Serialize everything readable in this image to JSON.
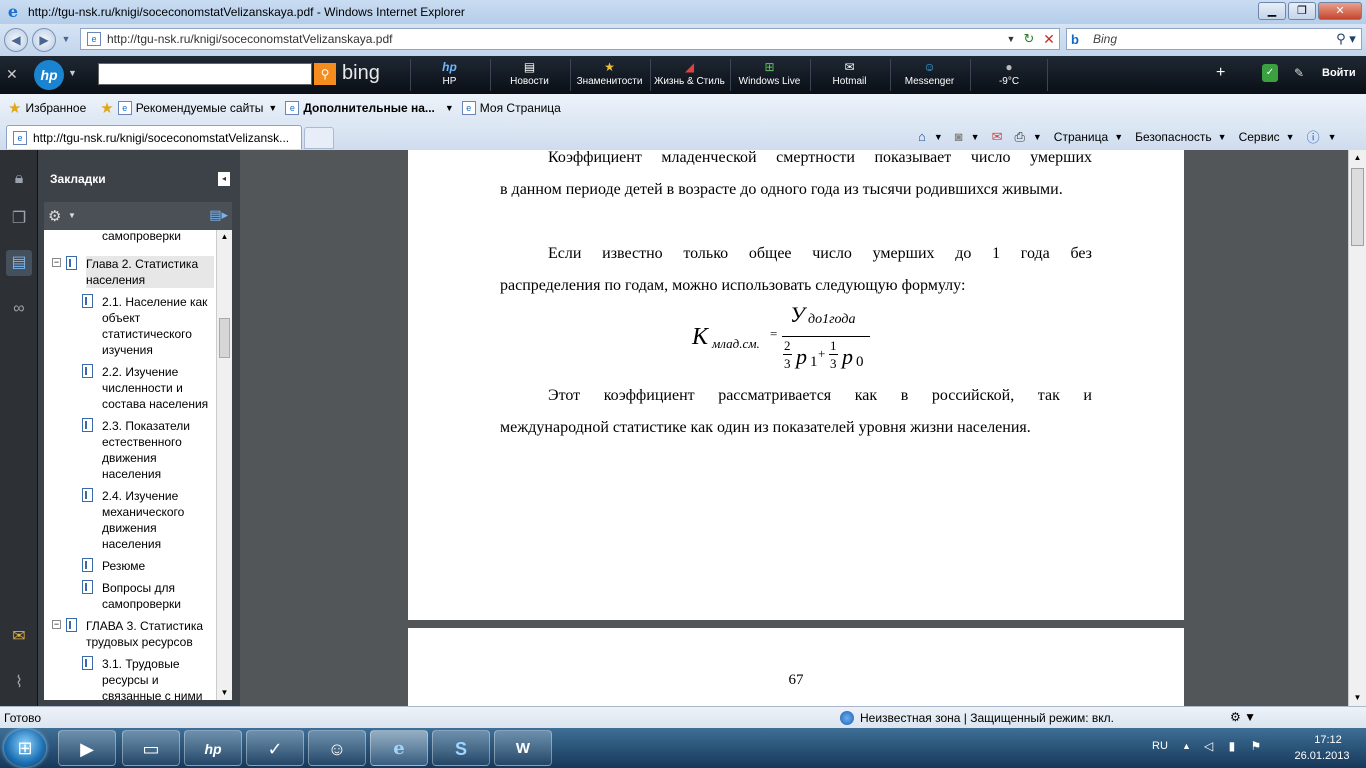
{
  "window": {
    "title": "http://tgu-nsk.ru/knigi/soceconomstatVelizanskaya.pdf - Windows Internet Explorer"
  },
  "address_bar": {
    "url": "http://tgu-nsk.ru/knigi/soceconomstatVelizanskaya.pdf",
    "search_placeholder": "Bing"
  },
  "hp_toolbar": {
    "search_value": "",
    "brand": "bing",
    "tools": [
      {
        "label": "HP",
        "icon": "hp-icon"
      },
      {
        "label": "Новости",
        "icon": "news-icon"
      },
      {
        "label": "Знаменитости",
        "icon": "star-icon"
      },
      {
        "label": "Жизнь & Стиль",
        "icon": "shoe-icon"
      },
      {
        "label": "Windows Live",
        "icon": "windows-icon"
      },
      {
        "label": "Hotmail",
        "icon": "mail-icon"
      },
      {
        "label": "Messenger",
        "icon": "messenger-icon"
      },
      {
        "label": "-9°C",
        "icon": "weather-icon"
      }
    ],
    "signin": "Войти"
  },
  "favorites_bar": {
    "favorites": "Избранное",
    "items": [
      "Рекомендуемые сайты",
      "Дополнительные на...",
      "Моя Страница"
    ]
  },
  "tabs": {
    "active_tab": "http://tgu-nsk.ru/knigi/soceconomstatVelizansk..."
  },
  "command_bar": {
    "page": "Страница",
    "safety": "Безопасность",
    "tools": "Сервис"
  },
  "bookmarks": {
    "header": "Закладки",
    "items": [
      {
        "text": "самопроверки",
        "level": 2
      },
      {
        "text": "Глава 2. Статистика населения",
        "level": 1,
        "expanded": true,
        "selected": true
      },
      {
        "text": "2.1. Население как объект статистического изучения",
        "level": 2
      },
      {
        "text": "2.2. Изучение численности и состава населения",
        "level": 2
      },
      {
        "text": "2.3. Показатели естественного движения населения",
        "level": 2
      },
      {
        "text": "2.4. Изучение механического движения населения",
        "level": 2
      },
      {
        "text": "Резюме",
        "level": 2
      },
      {
        "text": "Вопросы для самопроверки",
        "level": 2
      },
      {
        "text": "ГЛАВА 3. Статистика трудовых ресурсов",
        "level": 1,
        "expanded": true
      },
      {
        "text": "3.1. Трудовые ресурсы и связанные с ними",
        "level": 2
      }
    ]
  },
  "document": {
    "para1_line0": "Коэффициент младенческой смертности показывает число умерших",
    "para1_rest": "в данном периоде детей в возрасте до одного года из тысячи родившихся живыми.",
    "para2_first": "Если известно только общее число умерших до 1 года без",
    "para2_rest": "распределения по годам, можно использовать следующую формулу:",
    "formula": {
      "lhs": "К",
      "lhs_sub": "млад.см.",
      "eq": "=",
      "num": "У",
      "num_sub": "до1года",
      "frac1_num": "2",
      "frac1_den": "3",
      "p1": "p",
      "p1_sub": "1",
      "plus": "+",
      "frac2_num": "1",
      "frac2_den": "3",
      "p0": "p",
      "p0_sub": "0"
    },
    "para3_first": "Этот коэффициент рассматривается как в российской, так и",
    "para3_rest": "международной статистике как один из показателей уровня жизни населения.",
    "page_number": "67"
  },
  "status_bar": {
    "status": "Готово",
    "zone": "Неизвестная зона | Защищенный режим: вкл."
  },
  "taskbar": {
    "apps": [
      "media-player-icon",
      "explorer-folder-icon",
      "hp-icon",
      "hp-check-icon",
      "messenger-icon",
      "internet-explorer-icon",
      "skype-icon",
      "word-icon"
    ],
    "lang": "RU",
    "time": "17:12",
    "date": "26.01.2013"
  }
}
